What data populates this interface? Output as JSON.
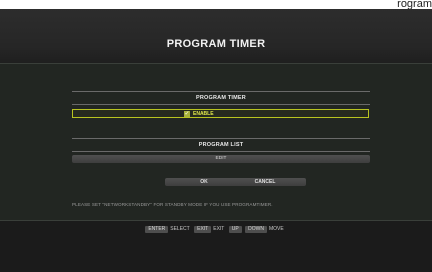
{
  "top_strip_text": "rogram",
  "title": "PROGRAM TIMER",
  "section_timer": "PROGRAM TIMER",
  "enable_label": "ENABLE",
  "enable_checked": true,
  "section_list": "PROGRAM LIST",
  "edit_label": "EDIT",
  "ok_label": "OK",
  "cancel_label": "CANCEL",
  "notice": "PLEASE SET \"NETWORKSTANDBY\" FOR STANDBY MODE IF YOU USE PROGRAMTIMER.",
  "help": {
    "enter_key": "ENTER",
    "enter_text": "SELECT",
    "exit_key": "EXIT",
    "exit_text": "EXIT",
    "up_key": "UP",
    "down_key": "DOWN",
    "move_text": "MOVE"
  }
}
